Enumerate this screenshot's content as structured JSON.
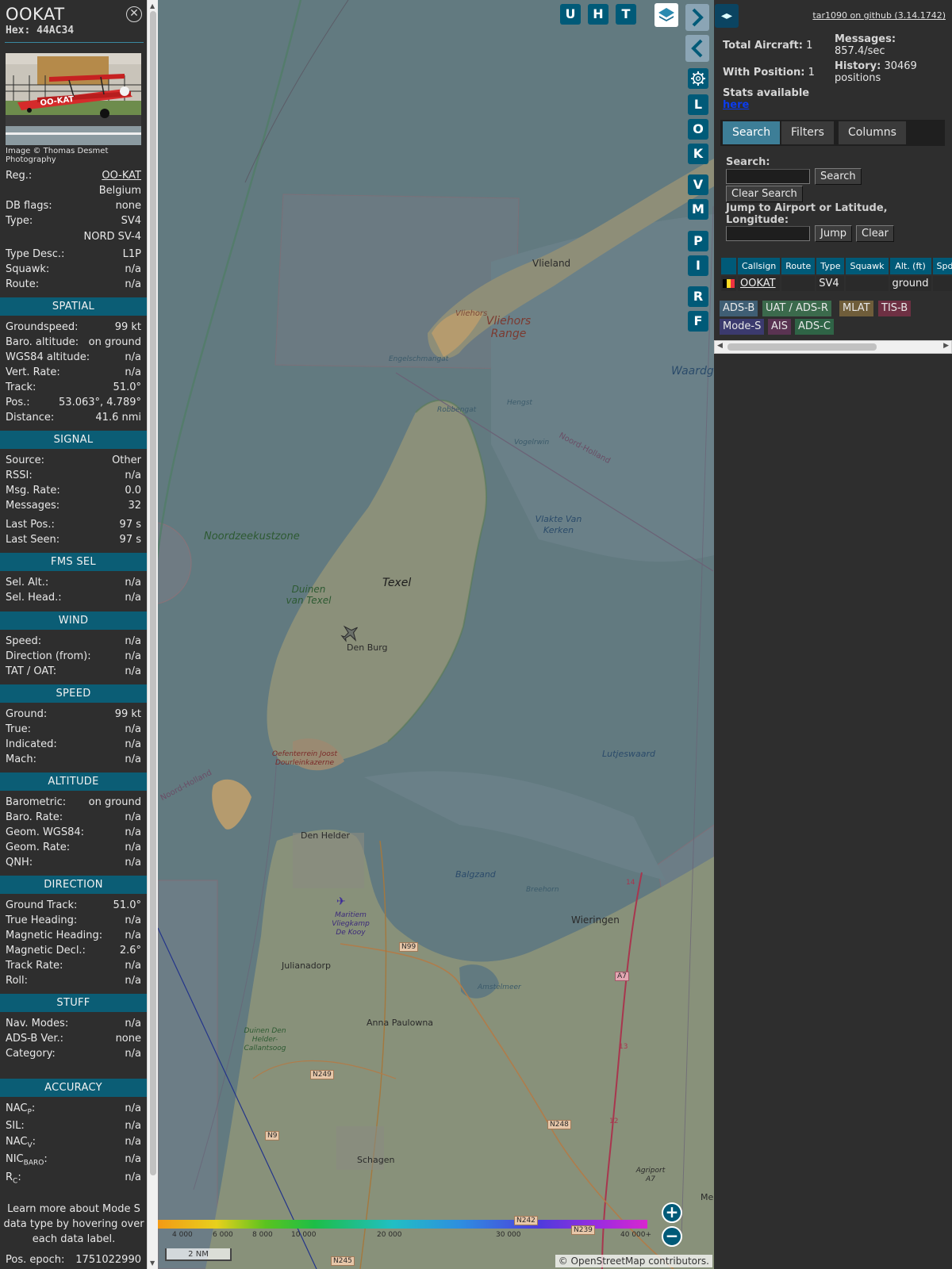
{
  "aircraft": {
    "callsign": "OOKAT",
    "hex_label": "Hex:",
    "hex": "44AC34",
    "photo_credit": "Image © Thomas Desmet Photography",
    "photo_reg_text": "OO-KAT"
  },
  "details": {
    "reg_label": "Reg.:",
    "reg": "OO-KAT",
    "country": "Belgium",
    "dbflags_label": "DB flags:",
    "dbflags": "none",
    "type_label": "Type:",
    "type": "SV4",
    "type_full": "NORD SV-4",
    "typedesc_label": "Type Desc.:",
    "typedesc": "L1P",
    "squawk_label": "Squawk:",
    "squawk": "n/a",
    "route_label": "Route:",
    "route": "n/a"
  },
  "spatial": {
    "title": "SPATIAL",
    "rows": [
      {
        "k": "Groundspeed:",
        "v": "99 kt"
      },
      {
        "k": "Baro. altitude:",
        "v": "on ground"
      },
      {
        "k": "WGS84 altitude:",
        "v": "n/a"
      },
      {
        "k": "Vert. Rate:",
        "v": "n/a"
      },
      {
        "k": "Track:",
        "v": "51.0°"
      },
      {
        "k": "Pos.:",
        "v": "53.063°, 4.789°"
      },
      {
        "k": "Distance:",
        "v": "41.6 nmi"
      }
    ]
  },
  "signal": {
    "title": "SIGNAL",
    "rows": [
      {
        "k": "Source:",
        "v": "Other"
      },
      {
        "k": "RSSI:",
        "v": "n/a"
      },
      {
        "k": "Msg. Rate:",
        "v": "0.0"
      },
      {
        "k": "Messages:",
        "v": "32"
      },
      {
        "k": "Last Pos.:",
        "v": "97 s"
      },
      {
        "k": "Last Seen:",
        "v": "97 s"
      }
    ]
  },
  "fms": {
    "title": "FMS SEL",
    "rows": [
      {
        "k": "Sel. Alt.:",
        "v": "n/a"
      },
      {
        "k": "Sel. Head.:",
        "v": "n/a"
      }
    ]
  },
  "wind": {
    "title": "WIND",
    "rows": [
      {
        "k": "Speed:",
        "v": "n/a"
      },
      {
        "k": "Direction (from):",
        "v": "n/a"
      },
      {
        "k": "TAT / OAT:",
        "v": "n/a"
      }
    ]
  },
  "speed": {
    "title": "SPEED",
    "rows": [
      {
        "k": "Ground:",
        "v": "99 kt"
      },
      {
        "k": "True:",
        "v": "n/a"
      },
      {
        "k": "Indicated:",
        "v": "n/a"
      },
      {
        "k": "Mach:",
        "v": "n/a"
      }
    ]
  },
  "altitude": {
    "title": "ALTITUDE",
    "rows": [
      {
        "k": "Barometric:",
        "v": "on ground"
      },
      {
        "k": "Baro. Rate:",
        "v": "n/a"
      },
      {
        "k": "Geom. WGS84:",
        "v": "n/a"
      },
      {
        "k": "Geom. Rate:",
        "v": "n/a"
      },
      {
        "k": "QNH:",
        "v": "n/a"
      }
    ]
  },
  "direction": {
    "title": "DIRECTION",
    "rows": [
      {
        "k": "Ground Track:",
        "v": "51.0°"
      },
      {
        "k": "True Heading:",
        "v": "n/a"
      },
      {
        "k": "Magnetic Heading:",
        "v": "n/a"
      },
      {
        "k": "Magnetic Decl.:",
        "v": "2.6°"
      },
      {
        "k": "Track Rate:",
        "v": "n/a"
      },
      {
        "k": "Roll:",
        "v": "n/a"
      }
    ]
  },
  "stuff": {
    "title": "STUFF",
    "rows": [
      {
        "k": "Nav. Modes:",
        "v": "n/a"
      },
      {
        "k": "ADS-B Ver.:",
        "v": "none"
      },
      {
        "k": "Category:",
        "v": "n/a"
      }
    ]
  },
  "accuracy": {
    "title": "ACCURACY",
    "nacp": "NAC",
    "nacp_sub": "P",
    "nacp_v": "n/a",
    "sil": "SIL:",
    "sil_v": "n/a",
    "nacv": "NAC",
    "nacv_sub": "V",
    "nacv_v": "n/a",
    "nicbaro": "NIC",
    "nicbaro_sub": "BARO",
    "nicbaro_v": "n/a",
    "rc": "R",
    "rc_sub": "C",
    "rc_v": "n/a"
  },
  "hint": "Learn more about Mode S data type by hovering over each data label.",
  "epoch_label": "Pos. epoch:",
  "epoch": "1751022990",
  "map": {
    "buttons": [
      "U",
      "H",
      "T"
    ],
    "side_buttons": [
      "L",
      "O",
      "K",
      "V",
      "M",
      "P",
      "I",
      "R",
      "F"
    ],
    "labels": {
      "vlieland": "Vlieland",
      "vliehors": "Vliehors",
      "vliehors_range": "Vliehors Range",
      "waardgronden": "Waardg",
      "engelschmangat": "Engelschmangat",
      "hengst": "Hengst",
      "robbengat": "Robbengat",
      "vogelrwin": "Vogelrwin",
      "noordholland": "Noord-Holland",
      "noordholland2": "Noord-Holland",
      "vlakte": "Vlakte Van Kerken",
      "noordzee": "Noordzeekustzone",
      "duinen": "Duinen van Texel",
      "texel": "Texel",
      "denburg": "Den Burg",
      "lutjeswaard": "Lutjeswaard",
      "oefenterrein": "Oefenterrein Joost Dourleinkazerne",
      "denhelder": "Den Helder",
      "balgzand": "Balgzand",
      "breehorn": "Breehorn",
      "wieringen": "Wieringen",
      "maritiem": "Maritiem Vliegkamp De Kooy",
      "julianadorp": "Julianadorp",
      "amstelmeer": "Amstelmeer",
      "annapaulowna": "Anna Paulowna",
      "duinen2": "Duinen Den Helder-Callantsoog",
      "schagen": "Schagen",
      "agriport": "Agriport A7",
      "me": "Me",
      "n99": "N99",
      "a7": "A7",
      "n249": "N249",
      "n248": "N248",
      "n9": "N9",
      "n245": "N245",
      "n242": "N242",
      "n239": "N239",
      "r14": "14",
      "r13": "13",
      "r12": "12"
    },
    "altitude_ticks": [
      "4 000",
      "6 000",
      "8 000",
      "10 000",
      "20 000",
      "30 000",
      "40 000+"
    ],
    "scale": "2 NM",
    "attribution_prefix": "© ",
    "attribution_link": "OpenStreetMap",
    "attribution_suffix": " contributors."
  },
  "right": {
    "github": "tar1090 on github (3.14.1742)",
    "total_label": "Total Aircraft:",
    "total": "1",
    "withpos_label": "With Position:",
    "withpos": "1",
    "messages_label": "Messages:",
    "messages": "857.4/sec",
    "history_label": "History:",
    "history": "30469 positions",
    "stats_label": "Stats available",
    "stats_link": "here",
    "tabs": [
      "Search",
      "Filters",
      "Columns"
    ],
    "search_label": "Search:",
    "search_btn": "Search",
    "clear_search_btn": "Clear Search",
    "jump_label": "Jump to Airport or Latitude, Longitude:",
    "jump_btn": "Jump",
    "clear_btn": "Clear",
    "table_headers": [
      "Callsign",
      "Route",
      "Type",
      "Squawk",
      "Alt. (ft)",
      "Spd."
    ],
    "table_row": {
      "callsign": "OOKAT",
      "route": "",
      "type": "SV4",
      "squawk": "",
      "alt": "ground",
      "spd": ""
    },
    "chips": [
      {
        "label": "ADS-B",
        "color": "#3f5e74"
      },
      {
        "label": "UAT / ADS-R",
        "color": "#3b6a4c"
      },
      {
        "label": "MLAT",
        "color": "#6f5d3a"
      },
      {
        "label": "TIS-B",
        "color": "#6e3043"
      },
      {
        "label": "Mode-S",
        "color": "#3b3a6e"
      },
      {
        "label": "AIS",
        "color": "#5a3352"
      },
      {
        "label": "ADS-C",
        "color": "#2f6446"
      }
    ]
  },
  "colors": {
    "section": "#0b5d75",
    "button": "#005a78",
    "active_tab": "#3d7e97"
  }
}
